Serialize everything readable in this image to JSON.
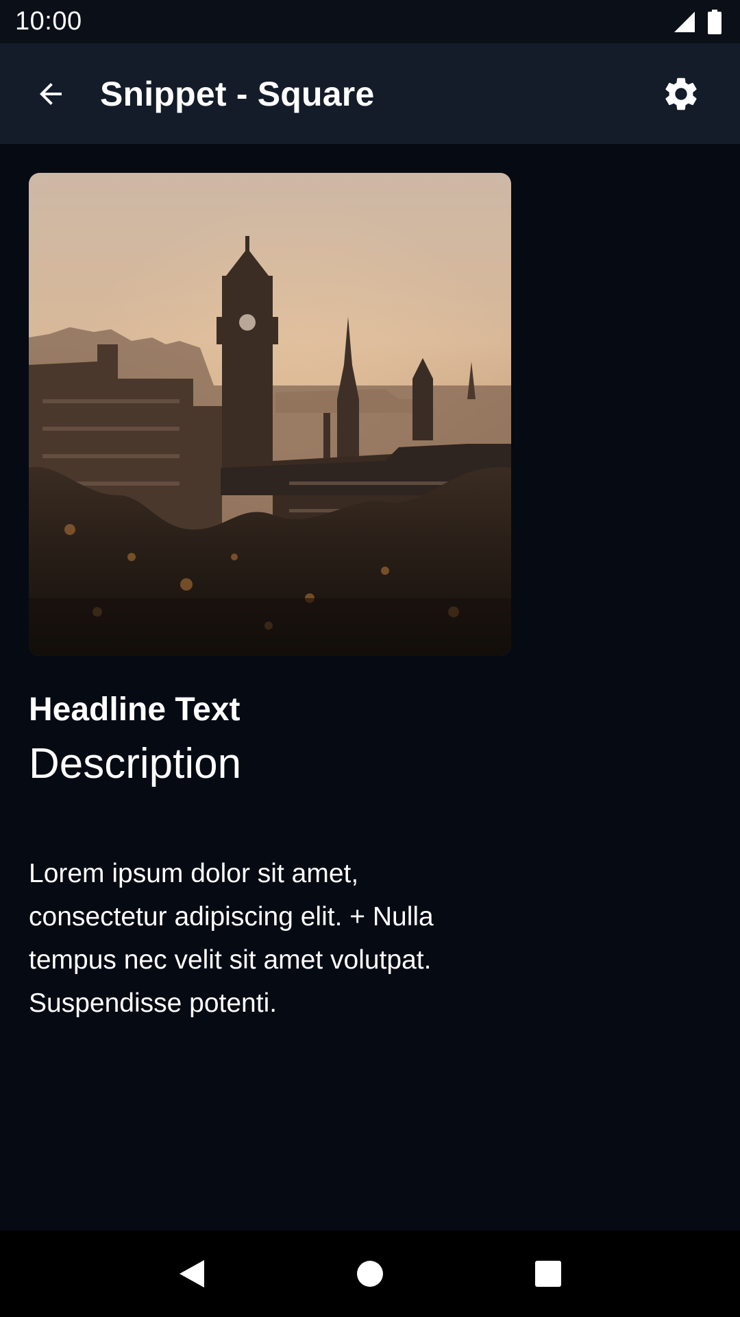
{
  "status_bar": {
    "time": "10:00",
    "icons": [
      "cellular-signal-icon",
      "battery-icon"
    ]
  },
  "app_bar": {
    "title": "Snippet - Square",
    "back_icon": "arrow-back-icon",
    "settings_icon": "gear-icon"
  },
  "card": {
    "image": "city-skyline-photo",
    "headline": "Headline Text",
    "description": "Description",
    "body_lines": [
      "Lorem ipsum dolor sit amet,",
      "consectetur adipiscing elit. + Nulla",
      "tempus nec velit sit amet volutpat.",
      "Suspendisse potenti."
    ]
  },
  "nav_bar": {
    "icons": [
      "nav-back-icon",
      "nav-home-icon",
      "nav-recents-icon"
    ]
  },
  "colors": {
    "background": "#060a13",
    "app_bar": "#141b29",
    "status_bar": "#0b0f18",
    "text": "#ffffff"
  }
}
